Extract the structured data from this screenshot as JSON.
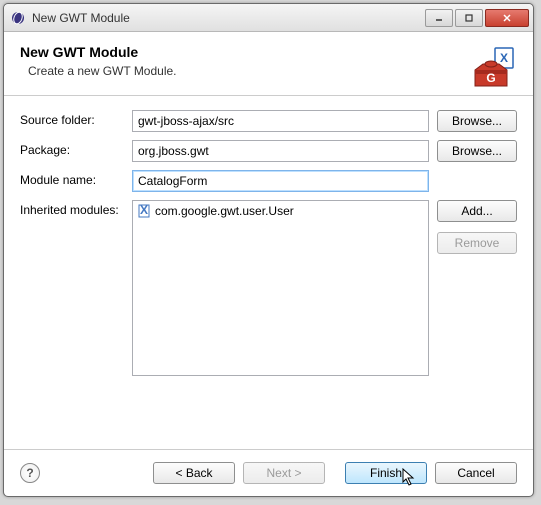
{
  "window": {
    "title": "New GWT Module"
  },
  "header": {
    "title": "New GWT Module",
    "subtitle": "Create a new GWT Module."
  },
  "form": {
    "sourceFolder": {
      "label": "Source folder:",
      "value": "gwt-jboss-ajax/src",
      "browse": "Browse..."
    },
    "packageField": {
      "label": "Package:",
      "value": "org.jboss.gwt",
      "browse": "Browse..."
    },
    "moduleName": {
      "label": "Module name:",
      "value": "CatalogForm"
    },
    "inherited": {
      "label": "Inherited modules:",
      "items": [
        "com.google.gwt.user.User"
      ],
      "add": "Add...",
      "remove": "Remove"
    }
  },
  "footer": {
    "back": "< Back",
    "next": "Next >",
    "finish": "Finish",
    "cancel": "Cancel"
  }
}
